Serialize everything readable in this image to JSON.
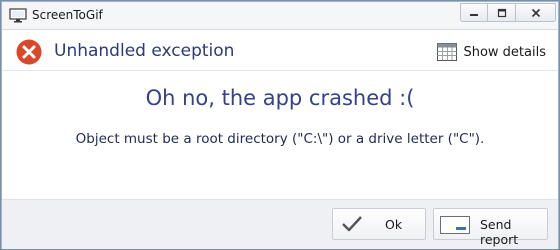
{
  "window": {
    "title": "ScreenToGif",
    "app_icon": "monitor-icon",
    "controls": {
      "minimize_icon": "minimize-icon",
      "maximize_icon": "maximize-icon",
      "close_icon": "close-icon"
    }
  },
  "header": {
    "icon": "error-icon",
    "title": "Unhandled exception",
    "show_details_icon": "grid-icon",
    "show_details_label": "Show details"
  },
  "content": {
    "headline": "Oh no, the app crashed :(",
    "message": "Object must be a root directory (\"C:\\\") or a drive letter (\"C\")."
  },
  "footer": {
    "ok_icon": "checkmark-icon",
    "ok_label": "Ok",
    "report_icon": "send-report-icon",
    "report_label": "Send report"
  },
  "colors": {
    "title_text": "#2b3a78",
    "headline_text": "#35428a",
    "error_red": "#d9482b",
    "footer_bg": "#eef0f3"
  }
}
